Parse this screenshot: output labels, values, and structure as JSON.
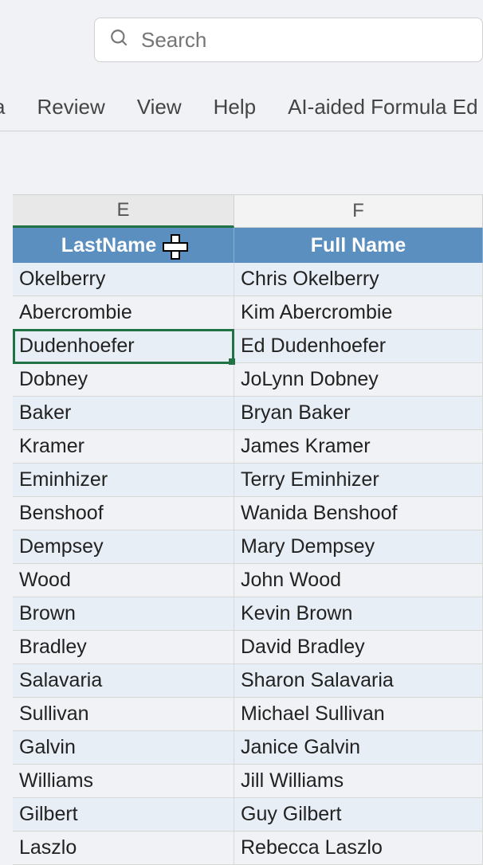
{
  "search": {
    "placeholder": "Search"
  },
  "ribbon": {
    "partial_left": "a",
    "items": [
      "Review",
      "View",
      "Help",
      "AI-aided Formula Ed"
    ]
  },
  "columns": {
    "e": "E",
    "f": "F"
  },
  "table": {
    "headers": {
      "lastName": "LastName",
      "fullName": "Full Name"
    },
    "rows": [
      {
        "lastName": "Okelberry",
        "fullName": "Chris Okelberry"
      },
      {
        "lastName": "Abercrombie",
        "fullName": "Kim Abercrombie"
      },
      {
        "lastName": "Dudenhoefer",
        "fullName": "Ed Dudenhoefer"
      },
      {
        "lastName": "Dobney",
        "fullName": "JoLynn Dobney"
      },
      {
        "lastName": "Baker",
        "fullName": "Bryan Baker"
      },
      {
        "lastName": "Kramer",
        "fullName": "James Kramer"
      },
      {
        "lastName": "Eminhizer",
        "fullName": "Terry Eminhizer"
      },
      {
        "lastName": "Benshoof",
        "fullName": "Wanida Benshoof"
      },
      {
        "lastName": "Dempsey",
        "fullName": "Mary Dempsey"
      },
      {
        "lastName": "Wood",
        "fullName": "John Wood"
      },
      {
        "lastName": "Brown",
        "fullName": "Kevin Brown"
      },
      {
        "lastName": "Bradley",
        "fullName": "David Bradley"
      },
      {
        "lastName": "Salavaria",
        "fullName": "Sharon Salavaria"
      },
      {
        "lastName": "Sullivan",
        "fullName": "Michael Sullivan"
      },
      {
        "lastName": "Galvin",
        "fullName": "Janice Galvin"
      },
      {
        "lastName": "Williams",
        "fullName": "Jill Williams"
      },
      {
        "lastName": "Gilbert",
        "fullName": "Guy Gilbert"
      },
      {
        "lastName": "Laszlo",
        "fullName": "Rebecca Laszlo"
      }
    ],
    "activeRowIndex": 2
  }
}
